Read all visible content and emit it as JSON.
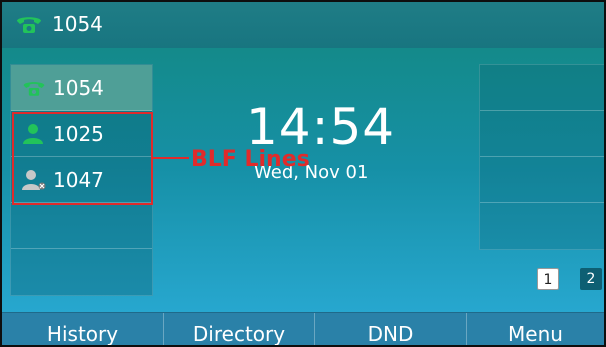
{
  "top_bar": {
    "account": "1054",
    "icon": "phone-handset-icon"
  },
  "lines": [
    {
      "number": "1054",
      "icon": "phone-handset-icon",
      "active": true
    },
    {
      "number": "1025",
      "icon": "user-online-icon",
      "active": false
    },
    {
      "number": "1047",
      "icon": "user-offline-icon",
      "active": false
    },
    {
      "number": "",
      "icon": "",
      "active": false
    },
    {
      "number": "",
      "icon": "",
      "active": false
    }
  ],
  "clock": {
    "time": "14:54",
    "date": "Wed, Nov 01"
  },
  "pages": [
    "1",
    "2"
  ],
  "annotation": {
    "label": "BLF Lines"
  },
  "softkeys": [
    "History",
    "Directory",
    "DND",
    "Menu"
  ],
  "colors": {
    "accent": "#e02b2b",
    "phone_green": "#22c35a",
    "screen_teal": "#148a8a"
  }
}
